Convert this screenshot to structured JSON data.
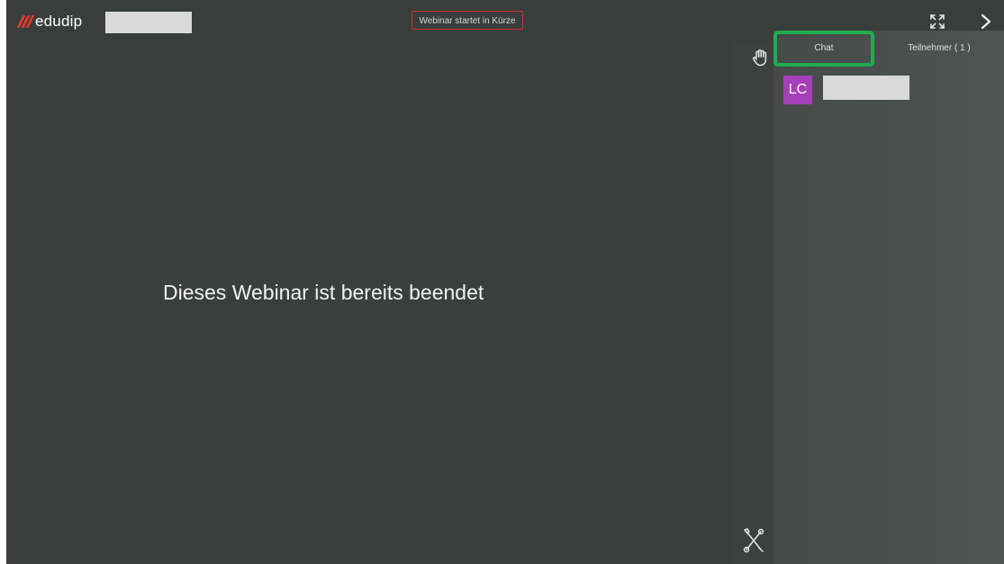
{
  "header": {
    "logo_text": "edudip",
    "status_label": "Webinar startet in Kürze",
    "icons": {
      "fullscreen": "fullscreen-icon",
      "collapse": "chevron-right-icon"
    }
  },
  "stage": {
    "message": "Dieses Webinar ist bereits beendet"
  },
  "toolstrip": {
    "icons": {
      "raise_hand": "raise-hand-icon",
      "tools": "tools-icon"
    }
  },
  "sidepanel": {
    "tabs": [
      {
        "label": "Chat",
        "active": true
      },
      {
        "label": "Teilnehmer ( 1 )",
        "active": false
      }
    ],
    "chat": {
      "entries": [
        {
          "avatar_initials": "LC",
          "avatar_color": "#a640b8"
        }
      ]
    }
  },
  "colors": {
    "brand_red": "#e63a2e",
    "highlight_green": "#1fac4f",
    "background": "#3a3e3c"
  }
}
